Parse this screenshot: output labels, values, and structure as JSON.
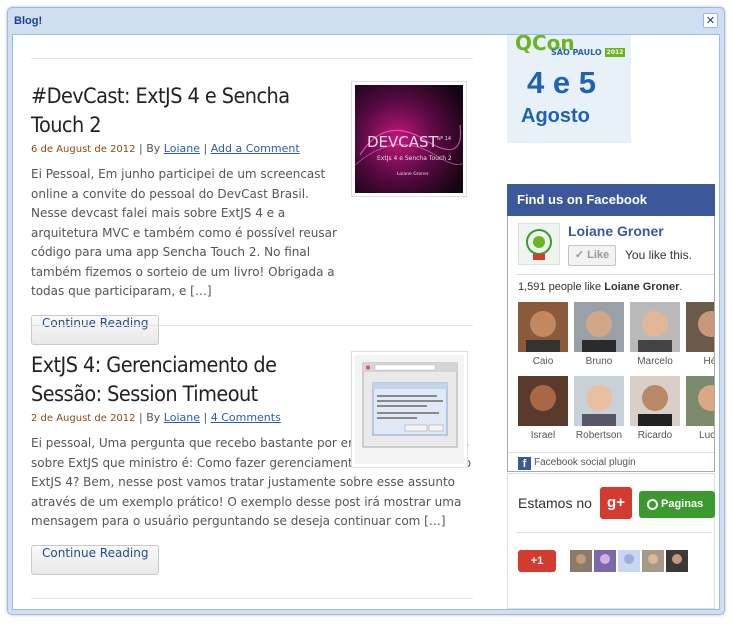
{
  "window": {
    "title": "Blog!",
    "close_glyph": "✕"
  },
  "posts": [
    {
      "title": "#DevCast: ExtJS 4 e Sencha Touch 2",
      "date": "6 de August de 2012",
      "by": "By",
      "author": "Loiane",
      "comments": "Add a Comment",
      "excerpt": "Ei Pessoal, Em junho participei de um screencast online a convite do pessoal do DevCast Brasil. Nesse devcast falei mais sobre ExtJS 4 e a arquitetura MVC e também como é possível reusar código para uma app Sencha Touch 2. No final também fizemos o sorteio de um livro! Obrigada a todas que participaram, e […]",
      "button": "Continue Reading",
      "thumb": {
        "big": "DEVCAST",
        "num": "Nº 14",
        "sub": "ExtJs 4 e Sencha Touch 2",
        "name": "Loiane Groner"
      }
    },
    {
      "title": "ExtJS 4: Gerenciamento de Sessão: Session Timeout",
      "date": "2 de August de 2012",
      "by": "By",
      "author": "Loiane",
      "comments": "4 Comments",
      "excerpt": "Ei pessoal, Uma pergunta que recebo bastante por email e nas palestras sobre ExtJS que ministro é: Como fazer gerenciamento de sessão usando ExtJS 4? Bem, nesse post vamos tratar justamente sobre esse assunto através de um exemplo prático! O exemplo desse post irá mostrar uma mensagem para o usuário perguntando se deseja continuar com […]",
      "button": "Continue Reading"
    }
  ],
  "qcon": {
    "logo": "QCon",
    "city": "SÃO PAULO",
    "year": "2012",
    "days": "4 e 5",
    "month": "Agosto"
  },
  "facebook": {
    "header": "Find us on Facebook",
    "page_name": "Loiane Groner",
    "like_label": "Like",
    "you_like": "You like this.",
    "count_prefix": "1,591 people like ",
    "count_name": "Loiane Groner",
    "count_suffix": ".",
    "fans": [
      "Caio",
      "Bruno",
      "Marcelo",
      "Hél",
      "Israel",
      "Robertson",
      "Ricardo",
      "Lucia"
    ],
    "footer": "Facebook social plugin"
  },
  "gplus": {
    "estamos": "Estamos no",
    "gplus_icon": "g+",
    "paginas": "Paginas",
    "plus1": "+1"
  },
  "colors": {
    "fb_blue": "#3b5998",
    "gplus_red": "#d23b2e",
    "green": "#3a9a2e",
    "title_blue": "#15428b"
  }
}
